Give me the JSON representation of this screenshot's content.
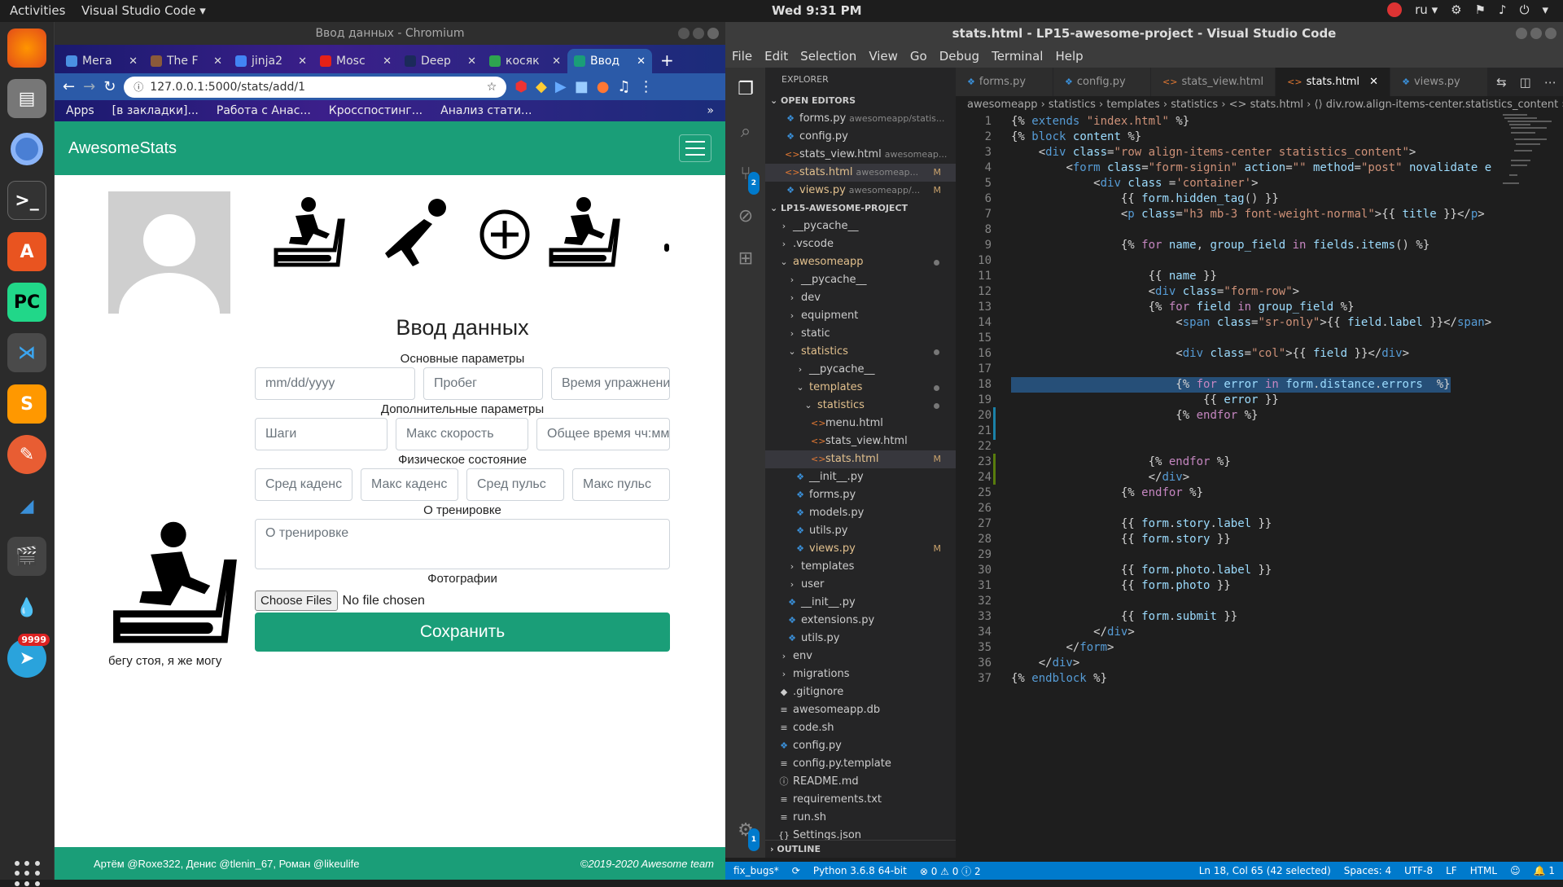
{
  "topbar": {
    "activities": "Activities",
    "app": "Visual Studio Code ▾",
    "clock": "Wed  9:31 PM",
    "lang": "ru ▾"
  },
  "dock": {
    "telegram_badge": "9999"
  },
  "chrome": {
    "window_title": "Ввод данных - Chromium",
    "tabs": [
      {
        "label": "Мега",
        "color": "#4a90e2"
      },
      {
        "label": "The F",
        "color": "#8a5a3a"
      },
      {
        "label": "jinja2",
        "color": "#4285f4"
      },
      {
        "label": "Mosc",
        "color": "#e62117"
      },
      {
        "label": "Deep",
        "color": "#1b2a5a"
      },
      {
        "label": "косяк",
        "color": "#2ea44f"
      },
      {
        "label": "Ввод",
        "color": "#1a9e78"
      }
    ],
    "url": "127.0.0.1:5000/stats/add/1",
    "bookmarks": [
      "Apps",
      "[в закладки]...",
      "Работа с Анас...",
      "Кросспостинг...",
      "Анализ стати..."
    ]
  },
  "site": {
    "brand": "AwesomeStats",
    "form_title": "Ввод данных",
    "sections": {
      "main": "Основные параметры",
      "extra": "Дополнительные параметры",
      "physical": "Физическое состояние",
      "about": "О тренировке",
      "photos": "Фотографии"
    },
    "fields": {
      "date": "mm/dd/yyyy",
      "distance": "Пробег",
      "exercise_time": "Время упражнения",
      "steps": "Шаги",
      "max_speed": "Макс скорость",
      "total_time": "Общее время чч:мм",
      "avg_cadence": "Сред каденс",
      "max_cadence": "Макс каденс",
      "avg_pulse": "Сред пульс",
      "max_pulse": "Макс пульс",
      "story": "О тренировке"
    },
    "choose_files": "Choose Files",
    "no_file": "No file chosen",
    "save": "Сохранить",
    "caption": "бегу стоя, я же могу",
    "footer_left": "Артём @Roxe322, Денис @tlenin_67, Роман @likeulife",
    "footer_right": "©2019-2020 Awesome team"
  },
  "vscode": {
    "window_title": "stats.html - LP15-awesome-project - Visual Studio Code",
    "menu": [
      "File",
      "Edit",
      "Selection",
      "View",
      "Go",
      "Debug",
      "Terminal",
      "Help"
    ],
    "explorer_header": "EXPLORER",
    "open_editors_header": "OPEN EDITORS",
    "project_header": "LP15-AWESOME-PROJECT",
    "outline_header": "OUTLINE",
    "scm_badge": "2",
    "settings_badge": "1",
    "tabs": [
      {
        "label": "forms.py",
        "icon": "py"
      },
      {
        "label": "config.py",
        "icon": "py"
      },
      {
        "label": "stats_view.html",
        "icon": "html"
      },
      {
        "label": "stats.html",
        "icon": "html"
      },
      {
        "label": "views.py",
        "icon": "py"
      }
    ],
    "breadcrumb": "awesomeapp › statistics › templates › statistics › <> stats.html › ⟨⟩ div.row.align-items-center.statistics_content › ⟨⟩ f",
    "status": {
      "branch": "fix_bugs*",
      "python": "Python 3.6.8 64-bit",
      "problems": "⊗ 0 ⚠ 0 ⓘ 2",
      "position": "Ln 18, Col 65 (42 selected)",
      "spaces": "Spaces: 4",
      "encoding": "UTF-8",
      "eol": "LF",
      "lang": "HTML",
      "bell": "🔔 1"
    }
  }
}
